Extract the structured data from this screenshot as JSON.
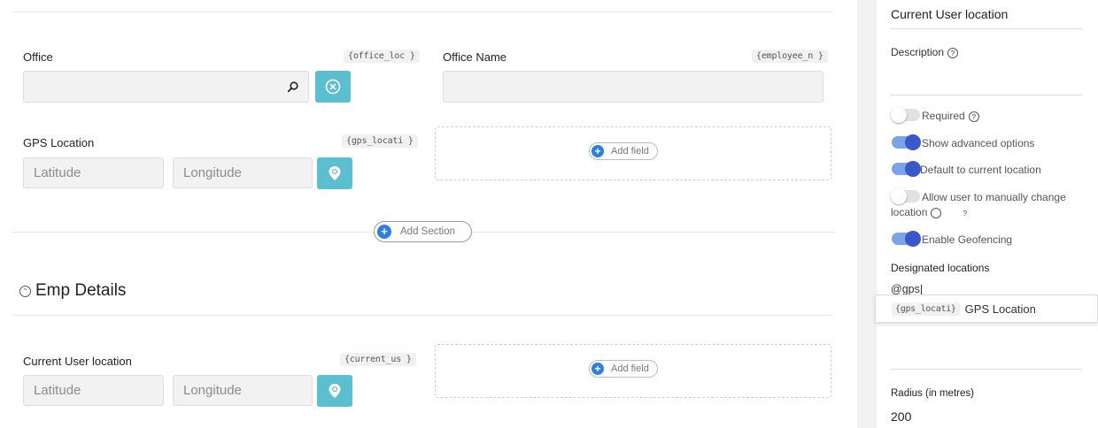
{
  "form": {
    "office": {
      "label": "Office",
      "key": "{office_loc }"
    },
    "office_name": {
      "label": "Office Name",
      "key": "{employee_n }"
    },
    "gps_location": {
      "label": "GPS Location",
      "key": "{gps_locati }",
      "latitude_placeholder": "Latitude",
      "longitude_placeholder": "Longitude"
    },
    "add_field_label": "Add field",
    "add_section_label": "Add Section",
    "section2": {
      "title": "Emp Details"
    },
    "current_user_location": {
      "label": "Current User location",
      "key": "{current_us }",
      "latitude_placeholder": "Latitude",
      "longitude_placeholder": "Longitude"
    }
  },
  "panel": {
    "field_title": "Current User location",
    "description_label": "Description",
    "toggles": [
      {
        "label": "Required",
        "on": false,
        "help": true
      },
      {
        "label": "Show advanced options",
        "on": true,
        "help": false
      },
      {
        "label": "Default to current location",
        "on": true,
        "help": false
      },
      {
        "label": "Allow user to manually change location",
        "on": false,
        "help": true
      },
      {
        "label": "Enable Geofencing",
        "on": true,
        "help": false
      }
    ],
    "designated_locations_label": "Designated locations",
    "designated_input_value": "@gps",
    "suggestion": {
      "key": "{gps_locati}",
      "label": "GPS Location"
    },
    "radius_label": "Radius (in metres)",
    "radius_value": "200"
  },
  "colors": {
    "teal": "#5bbfcf",
    "toggle_knob_on": "#3a58c9",
    "toggle_track_on": "#7aa4ea",
    "add_icon": "#2d7fe0"
  },
  "icons": {
    "search": "search-icon",
    "clear": "close-circle-icon",
    "location": "map-pin-icon",
    "help": "help-circle-icon",
    "add": "plus-circle-icon",
    "collapse": "chevron-up-circle-icon"
  }
}
